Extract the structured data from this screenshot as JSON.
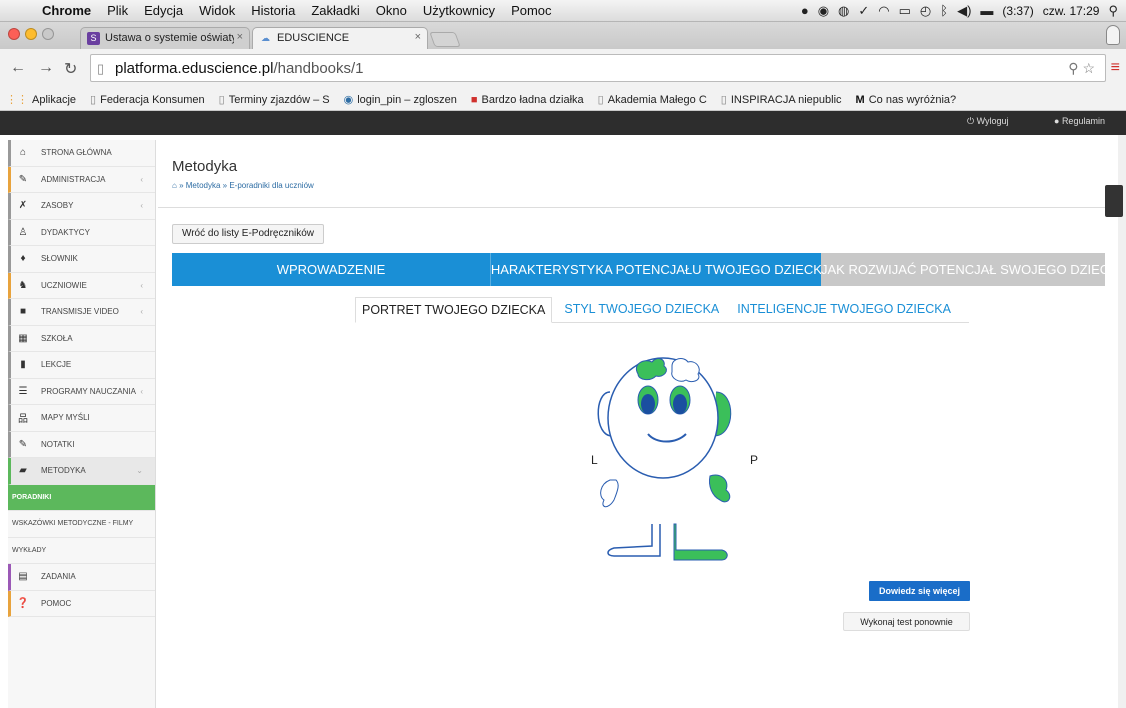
{
  "menubar": {
    "app": "Chrome",
    "items": [
      "Plik",
      "Edycja",
      "Widok",
      "Historia",
      "Zakładki",
      "Okno",
      "Użytkownicy",
      "Pomoc"
    ],
    "battery": "(3:37)",
    "datetime": "czw. 17:29"
  },
  "tabs": [
    {
      "title": "Ustawa o systemie oświaty",
      "icon": "s-favicon",
      "active": false
    },
    {
      "title": "EDUSCIENCE",
      "icon": "eduscience-favicon",
      "active": true
    }
  ],
  "address": {
    "host": "platforma.eduscience.pl",
    "path": "/handbooks/1"
  },
  "bookmarks": [
    {
      "label": "Aplikacje",
      "icon": "apps-grid-icon"
    },
    {
      "label": "Federacja Konsumen",
      "icon": "page-icon"
    },
    {
      "label": "Terminy zjazdów – S",
      "icon": "page-icon"
    },
    {
      "label": "login_pin – zgloszen",
      "icon": "globe-icon"
    },
    {
      "label": "Bardzo ładna działka",
      "icon": "red-flag-icon"
    },
    {
      "label": "Akademia Małego C",
      "icon": "page-icon"
    },
    {
      "label": "INSPIRACJA niepublic",
      "icon": "page-icon"
    },
    {
      "label": "Co nas wyróżnia?",
      "icon": "m-icon"
    }
  ],
  "site": {
    "logout": "Wyloguj",
    "terms": "Regulamin"
  },
  "sidebar": {
    "items": [
      {
        "label": "STRONA GŁÓWNA",
        "icon": "home-icon",
        "color": "#999999",
        "arrow": false
      },
      {
        "label": "ADMINISTRACJA",
        "icon": "wrench-icon",
        "color": "#e8a33d",
        "arrow": true
      },
      {
        "label": "ZASOBY",
        "icon": "tools-icon",
        "color": "#999999",
        "arrow": true
      },
      {
        "label": "DYDAKTYCY",
        "icon": "teacher-icon",
        "color": "#999999",
        "arrow": false
      },
      {
        "label": "SŁOWNIK",
        "icon": "pin-icon",
        "color": "#999999",
        "arrow": false
      },
      {
        "label": "UCZNIOWIE",
        "icon": "students-icon",
        "color": "#e8a33d",
        "arrow": true
      },
      {
        "label": "TRANSMISJE VIDEO",
        "icon": "video-icon",
        "color": "#999999",
        "arrow": true
      },
      {
        "label": "SZKOŁA",
        "icon": "building-icon",
        "color": "#999999",
        "arrow": false
      },
      {
        "label": "LEKCJE",
        "icon": "book-icon",
        "color": "#999999",
        "arrow": false
      },
      {
        "label": "PROGRAMY NAUCZANIA",
        "icon": "list-icon",
        "color": "#999999",
        "arrow": true
      },
      {
        "label": "MAPY MYŚLI",
        "icon": "sitemap-icon",
        "color": "#999999",
        "arrow": false
      },
      {
        "label": "NOTATKI",
        "icon": "pencil-icon",
        "color": "#999999",
        "arrow": false
      },
      {
        "label": "METODYKA",
        "icon": "notebook-icon",
        "color": "#5cb85c",
        "arrow": true,
        "active": true
      }
    ],
    "subitems": [
      "PORADNIKI",
      "WSKAZÓWKI METODYCZNE - FILMY",
      "WYKŁADY"
    ],
    "items_after": [
      {
        "label": "ZADANIA",
        "icon": "calendar-icon",
        "color": "#9b59b6"
      },
      {
        "label": "POMOC",
        "icon": "question-icon",
        "color": "#e8a33d"
      }
    ]
  },
  "main": {
    "title": "Metodyka",
    "breadcrumb": "» Metodyka » E-poradniki dla uczniów",
    "back_button": "Wróć do listy E-Podręczników",
    "big_tabs": [
      {
        "label": "WPROWADZENIE",
        "color": "#1a8fd6"
      },
      {
        "label": "CHARAKTERYSTYKA POTENCJAŁU TWOJEGO DZIECKA",
        "color": "#1a8fd6"
      },
      {
        "label": "JAK ROZWIJAĆ POTENCJAŁ SWOJEGO DZIECKA?",
        "color": "#c8c8c8"
      }
    ],
    "sub_tabs": [
      {
        "label": "PORTRET TWOJEGO DZIECKA",
        "active": true
      },
      {
        "label": "STYL TWOJEGO DZIECKA",
        "active": false
      },
      {
        "label": "INTELIGENCJE TWOJEGO DZIECKA",
        "active": false
      }
    ],
    "figure_left": "L",
    "figure_right": "P",
    "learn_more": "Dowiedz się więcej",
    "retake": "Wykonaj test ponownie"
  }
}
